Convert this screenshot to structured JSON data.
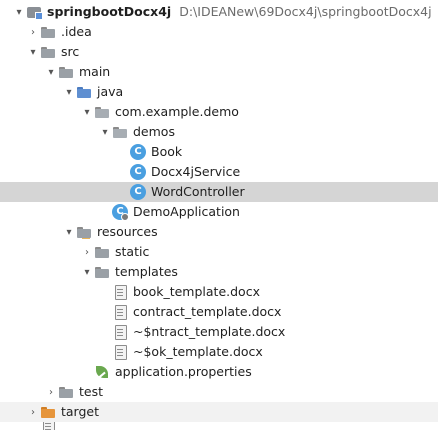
{
  "root": {
    "name": "springbootDocx4j",
    "path": "D:\\IDEANew\\69Docx4j\\springbootDocx4j"
  },
  "tree": [
    {
      "id": "idea",
      "label": ".idea"
    },
    {
      "id": "src",
      "label": "src"
    },
    {
      "id": "main",
      "label": "main"
    },
    {
      "id": "java",
      "label": "java"
    },
    {
      "id": "pkg",
      "label": "com.example.demo"
    },
    {
      "id": "demos",
      "label": "demos"
    },
    {
      "id": "book",
      "label": "Book"
    },
    {
      "id": "docx4jservice",
      "label": "Docx4jService"
    },
    {
      "id": "wordcontroller",
      "label": "WordController"
    },
    {
      "id": "demoapplication",
      "label": "DemoApplication"
    },
    {
      "id": "resources",
      "label": "resources"
    },
    {
      "id": "static",
      "label": "static"
    },
    {
      "id": "templates",
      "label": "templates"
    },
    {
      "id": "book_template",
      "label": "book_template.docx"
    },
    {
      "id": "contract_template",
      "label": "contract_template.docx"
    },
    {
      "id": "tmp1",
      "label": "~$ntract_template.docx"
    },
    {
      "id": "tmp2",
      "label": "~$ok_template.docx"
    },
    {
      "id": "app_props",
      "label": "application.properties"
    },
    {
      "id": "test",
      "label": "test"
    },
    {
      "id": "target",
      "label": "target"
    }
  ],
  "class_icon_letter": "C",
  "colors": {
    "selection": "#d5d5d5",
    "java_folder": "#5f8fd1",
    "target_folder": "#e6953b",
    "class_icon": "#4a9fe0"
  }
}
